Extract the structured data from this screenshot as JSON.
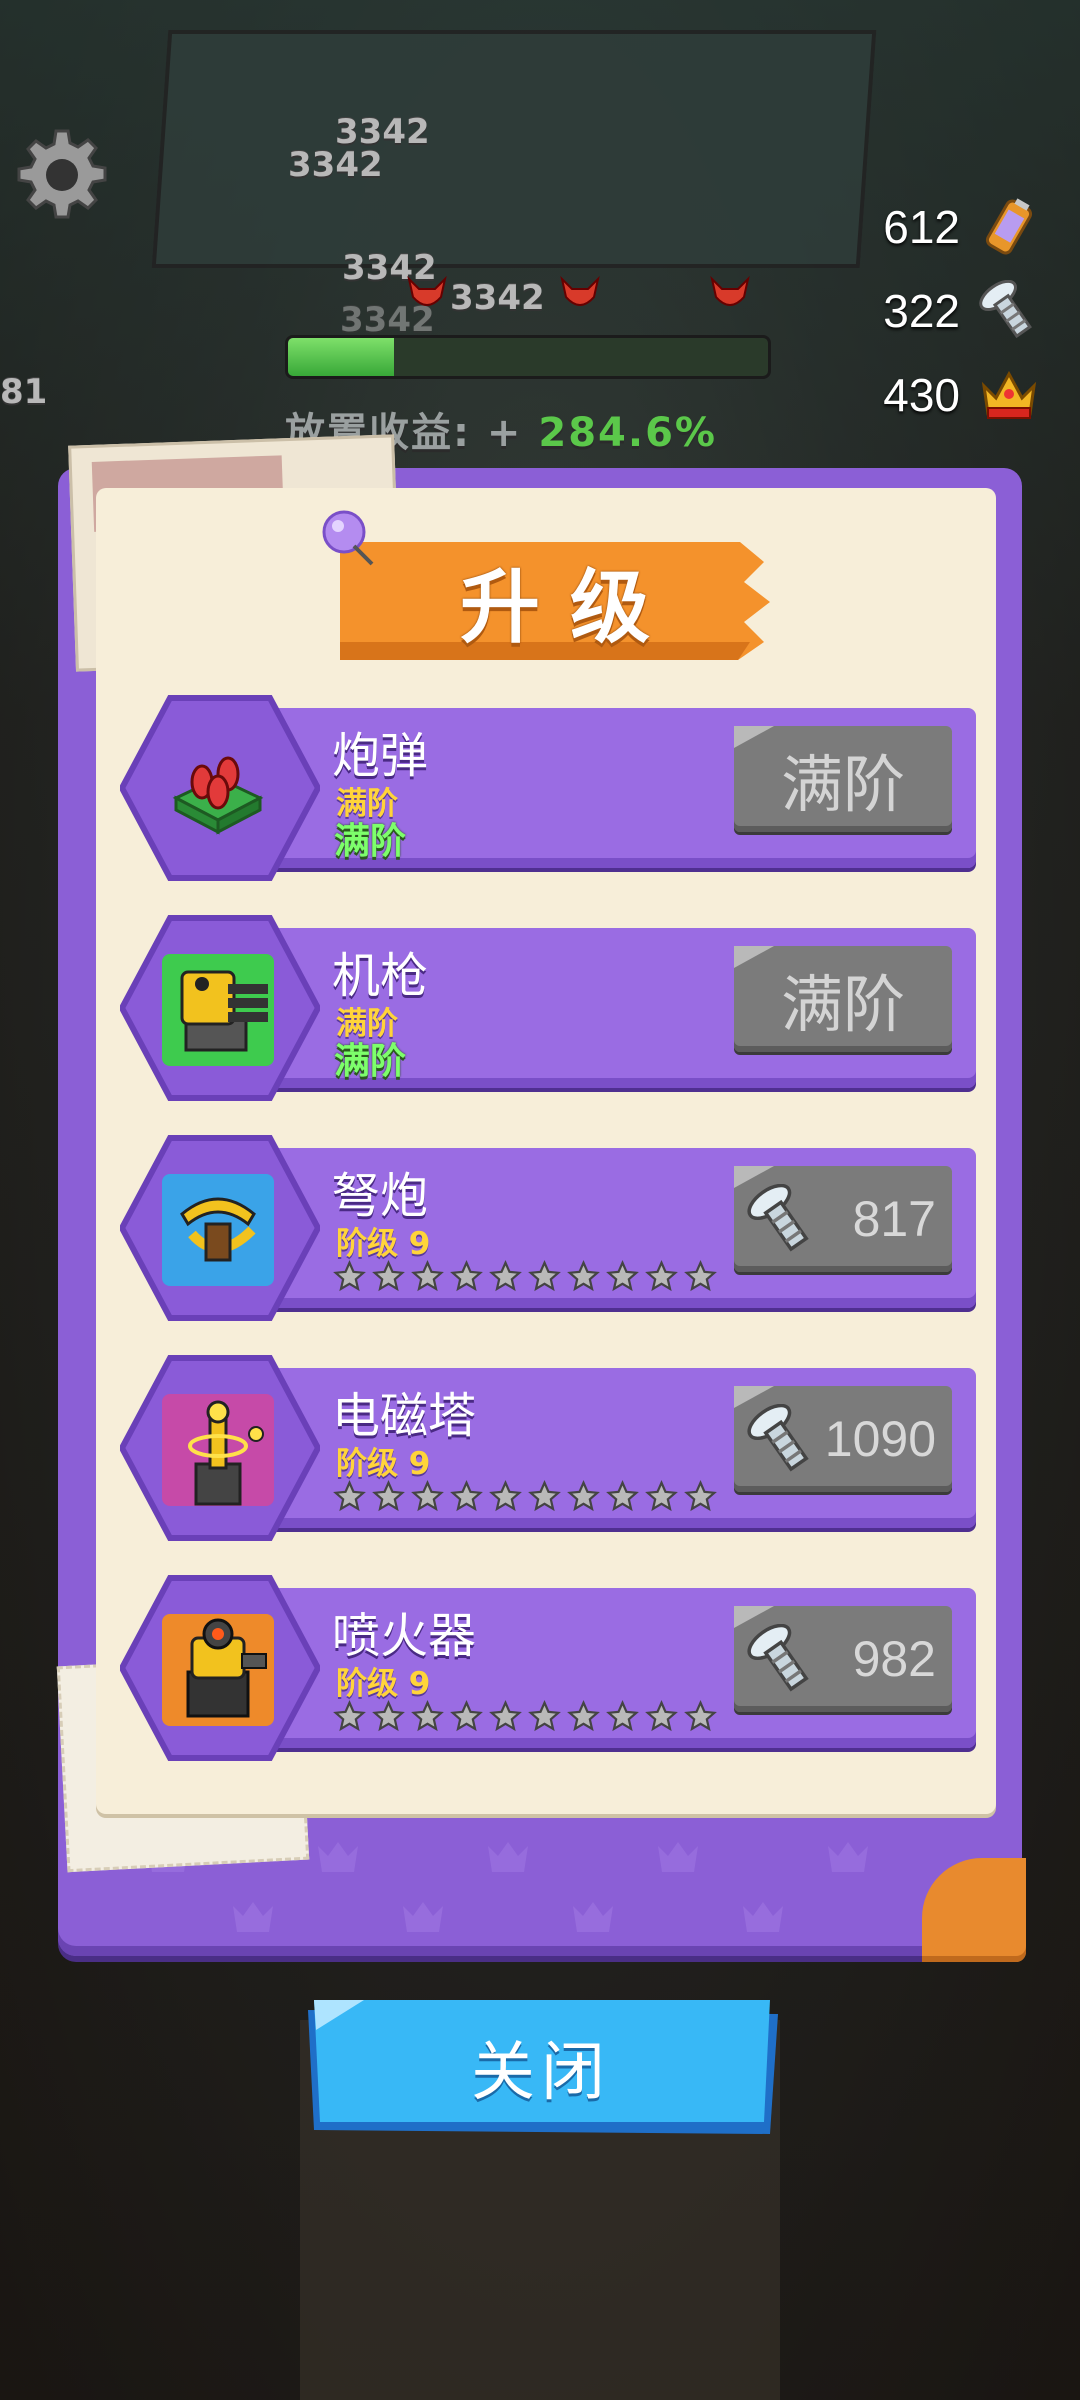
{
  "colors": {
    "panel": "#8b5fd6",
    "row_bar": "#9a6ce3",
    "title_banner": "#f4922c",
    "maxed_green": "#7dff6b",
    "level_yellow": "#ffd43a",
    "close_button": "#34b4f4",
    "disabled_button": "#7b7b7b"
  },
  "background": {
    "damage_numbers": [
      "3342",
      "3342",
      "3342",
      "3342",
      "3342",
      "81"
    ],
    "idle_label": "放置收益: + ",
    "idle_percent": "284.6%",
    "enemy_hp_fraction": 0.22
  },
  "settings": {
    "icon": "gear-icon"
  },
  "resources": [
    {
      "value": "612",
      "icon": "battery-icon"
    },
    {
      "value": "322",
      "icon": "screw-icon"
    },
    {
      "value": "430",
      "icon": "crown-icon"
    }
  ],
  "dialog": {
    "title": "升级",
    "items": [
      {
        "name": "炮弹",
        "status": "满阶",
        "maxed_label": "满阶",
        "button": "满阶",
        "stars": 0,
        "icon": "cannonball-turret-icon"
      },
      {
        "name": "机枪",
        "status": "满阶",
        "maxed_label": "满阶",
        "button": "满阶",
        "stars": 0,
        "icon": "machine-gun-turret-icon"
      },
      {
        "name": "弩炮",
        "status": "阶级 9",
        "cost": "817",
        "stars": 10,
        "filled_stars": 0,
        "icon": "ballista-turret-icon"
      },
      {
        "name": "电磁塔",
        "status": "阶级 9",
        "cost": "1090",
        "stars": 10,
        "filled_stars": 0,
        "icon": "tesla-tower-icon"
      },
      {
        "name": "喷火器",
        "status": "阶级 9",
        "cost": "982",
        "stars": 10,
        "filled_stars": 0,
        "icon": "flamethrower-turret-icon"
      }
    ]
  },
  "close_button": "关闭"
}
